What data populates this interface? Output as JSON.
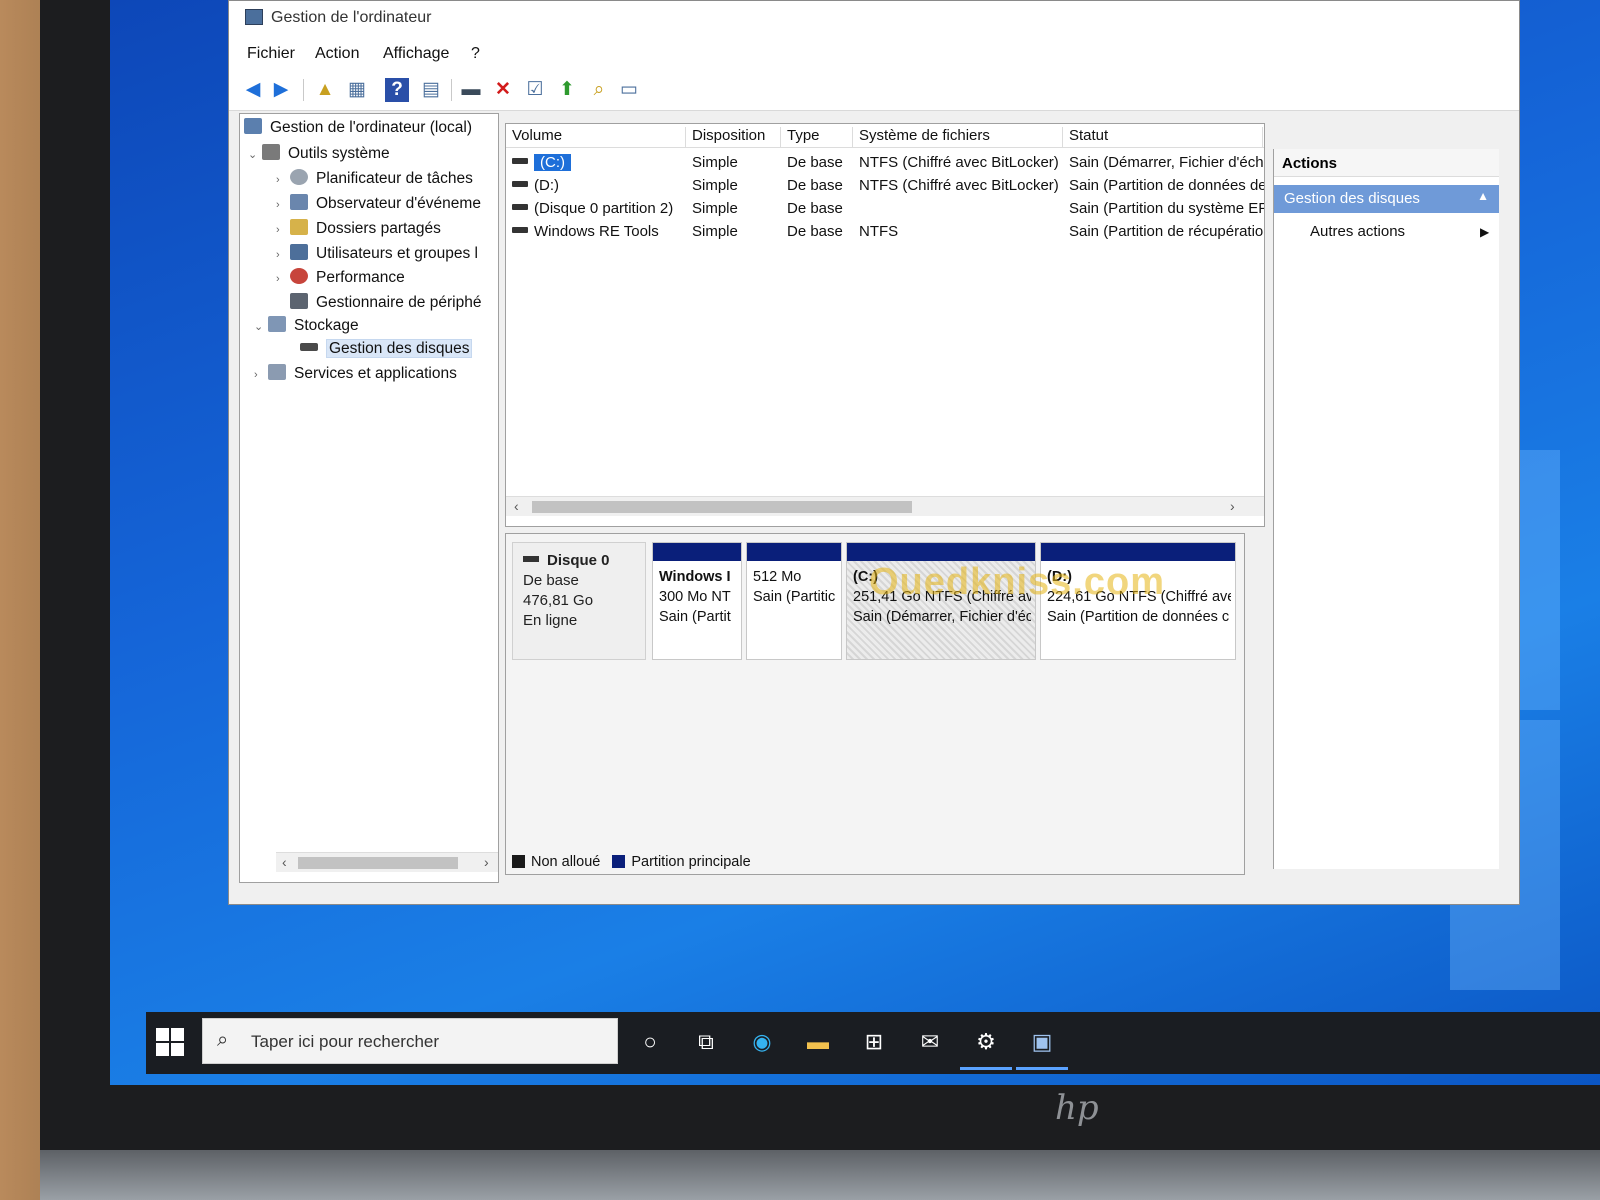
{
  "window": {
    "title": "Gestion de l'ordinateur",
    "controls": {
      "minimize": "—",
      "maximize": "☐",
      "close": "✕"
    }
  },
  "menu": {
    "items": [
      "Fichier",
      "Action",
      "Affichage",
      "?"
    ]
  },
  "toolbar": {
    "icons": [
      "arrow-left-icon",
      "arrow-right-icon",
      "up-folder-icon",
      "show-hide-console-tree-icon",
      "help-icon",
      "properties-icon",
      "connect-icon",
      "delete-icon",
      "checklist-icon",
      "up-arrow-icon",
      "search-icon",
      "view-icon"
    ]
  },
  "tree": {
    "root": "Gestion de l'ordinateur (local)",
    "system_tools": "Outils système",
    "items": [
      "Planificateur de tâches",
      "Observateur d'événeme",
      "Dossiers partagés",
      "Utilisateurs et groupes l",
      "Performance",
      "Gestionnaire de périphé"
    ],
    "storage": "Stockage",
    "disk_management": "Gestion des disques",
    "services": "Services et applications"
  },
  "volume_table": {
    "columns": [
      "Volume",
      "Disposition",
      "Type",
      "Système de fichiers",
      "Statut"
    ],
    "rows": [
      {
        "volume": "(C:)",
        "layout": "Simple",
        "type": "De base",
        "fs": "NTFS (Chiffré avec BitLocker)",
        "status": "Sain (Démarrer, Fichier d'écha"
      },
      {
        "volume": "(D:)",
        "layout": "Simple",
        "type": "De base",
        "fs": "NTFS (Chiffré avec BitLocker)",
        "status": "Sain (Partition de données de"
      },
      {
        "volume": "(Disque 0 partition 2)",
        "layout": "Simple",
        "type": "De base",
        "fs": "",
        "status": "Sain (Partition du système EFI"
      },
      {
        "volume": "Windows RE Tools",
        "layout": "Simple",
        "type": "De base",
        "fs": "NTFS",
        "status": "Sain (Partition de récupératior"
      }
    ]
  },
  "disk_map": {
    "disk_name": "Disque 0",
    "disk_type": "De base",
    "disk_size": "476,81 Go",
    "disk_state": "En ligne",
    "partitions": [
      {
        "title": "Windows I",
        "line1": "300 Mo NT",
        "line2": "Sain (Partit"
      },
      {
        "title": "",
        "line1": "512 Mo",
        "line2": "Sain (Partitic"
      },
      {
        "title": "(C:)",
        "line1": "251,41 Go NTFS (Chiffré ave",
        "line2": "Sain (Démarrer, Fichier d'éc"
      },
      {
        "title": "(D:)",
        "line1": "224,61 Go NTFS (Chiffré ave",
        "line2": "Sain (Partition de données c"
      }
    ],
    "legend": {
      "unallocated": "Non alloué",
      "primary": "Partition principale"
    },
    "colors": {
      "partition_bar": "#0a1f7a",
      "unallocated": "#1a1a1a",
      "primary": "#0a1f7a"
    }
  },
  "watermark": "Ouedkniss.com",
  "actions": {
    "header": "Actions",
    "section": "Gestion des disques",
    "item": "Autres actions"
  },
  "taskbar": {
    "search_placeholder": "Taper ici pour rechercher",
    "icons": [
      "cortana-icon",
      "task-view-icon",
      "edge-icon",
      "file-explorer-icon",
      "store-icon",
      "mail-icon",
      "settings-icon",
      "computer-management-icon"
    ]
  },
  "brand": {
    "laptop_logo": "hp"
  }
}
